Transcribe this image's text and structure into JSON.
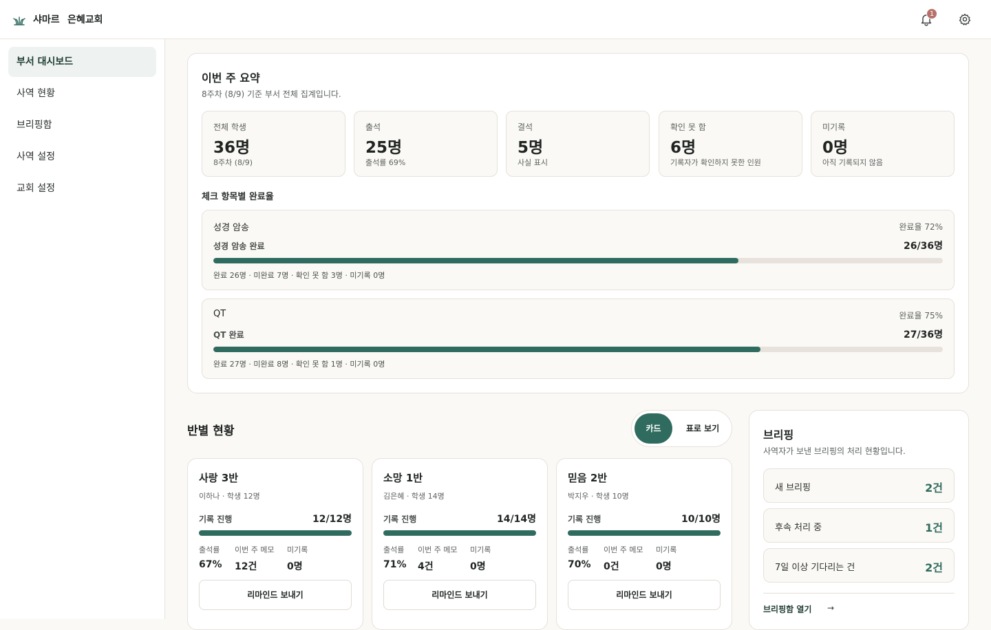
{
  "header": {
    "brand": "샤마르",
    "church": "은혜교회",
    "notification_count": "1"
  },
  "sidebar": {
    "items": [
      {
        "label": "부서 대시보드",
        "active": true
      },
      {
        "label": "사역 현황"
      },
      {
        "label": "브리핑함"
      },
      {
        "label": "사역 설정"
      },
      {
        "label": "교회 설정"
      }
    ]
  },
  "summary": {
    "title": "이번 주 요약",
    "subtitle": "8주차 (8/9) 기준 부서 전체 집계입니다.",
    "stats": [
      {
        "label": "전체 학생",
        "value": "36명",
        "note": "8주차 (8/9)"
      },
      {
        "label": "출석",
        "value": "25명",
        "note": "출석률 69%"
      },
      {
        "label": "결석",
        "value": "5명",
        "note": "사실 표시"
      },
      {
        "label": "확인 못 함",
        "value": "6명",
        "note": "기록자가 확인하지 못한 인원"
      },
      {
        "label": "미기록",
        "value": "0명",
        "note": "아직 기록되지 않음"
      }
    ],
    "checks_title": "체크 항목별 완료율",
    "checks": [
      {
        "name": "성경 암송",
        "rate": "완료율 72%",
        "done_label": "성경 암송 완료",
        "done_count": "26/36명",
        "progress": 0.72,
        "footer": "완료 26명 · 미완료 7명 · 확인 못 함 3명 · 미기록 0명"
      },
      {
        "name": "QT",
        "rate": "완료율 75%",
        "done_label": "QT 완료",
        "done_count": "27/36명",
        "progress": 0.75,
        "footer": "완료 27명 · 미완료 8명 · 확인 못 함 1명 · 미기록 0명"
      }
    ]
  },
  "classes": {
    "title": "반별 현황",
    "toggle": {
      "card": "카드",
      "table": "표로 보기"
    },
    "progress_label": "기록 진행",
    "metric_labels": {
      "attendance": "출석률",
      "memo": "이번 주 메모",
      "unrecorded": "미기록"
    },
    "remind_label": "리마인드 보내기",
    "items": [
      {
        "name": "사랑 3반",
        "meta": "이하나 · 학생 12명",
        "progress_count": "12/12명",
        "progress": 1.0,
        "attendance": "67%",
        "memo": "12건",
        "unrecorded": "0명"
      },
      {
        "name": "소망 1반",
        "meta": "김은혜 · 학생 14명",
        "progress_count": "14/14명",
        "progress": 1.0,
        "attendance": "71%",
        "memo": "4건",
        "unrecorded": "0명"
      },
      {
        "name": "믿음 2반",
        "meta": "박지우 · 학생 10명",
        "progress_count": "10/10명",
        "progress": 1.0,
        "attendance": "70%",
        "memo": "0건",
        "unrecorded": "0명"
      }
    ]
  },
  "briefing": {
    "title": "브리핑",
    "subtitle": "사역자가 보낸 브리핑의 처리 현황입니다.",
    "items": [
      {
        "label": "새 브리핑",
        "value": "2건"
      },
      {
        "label": "후속 처리 중",
        "value": "1건"
      },
      {
        "label": "7일 이상 기다리는 건",
        "value": "2건"
      }
    ],
    "link": "브리핑함 열기"
  },
  "colors": {
    "accent": "#2f6b5e",
    "badge": "#b8706a"
  },
  "icons": {
    "logo": "sprout-icon",
    "notifications": "bell-icon",
    "settings": "gear-icon",
    "link": "arrow-right-icon"
  }
}
